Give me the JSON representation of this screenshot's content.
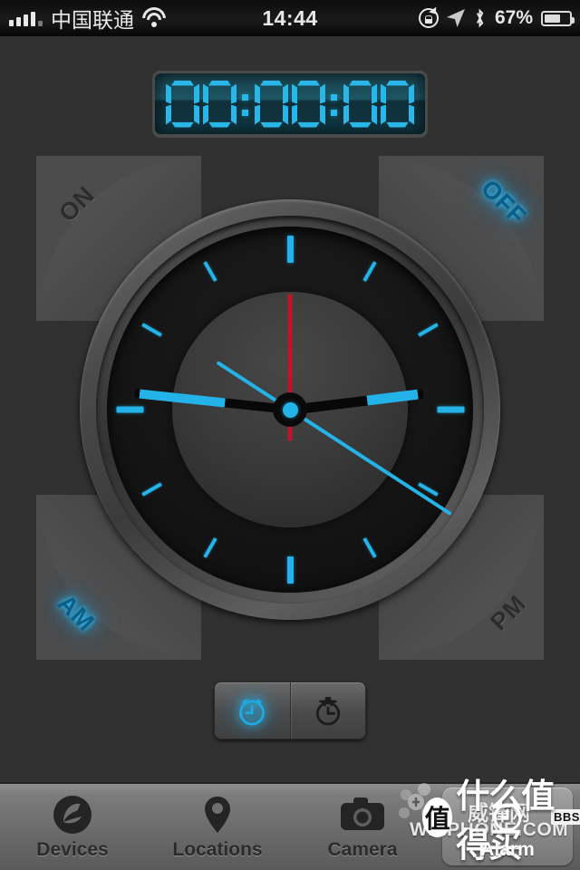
{
  "status_bar": {
    "carrier": "中国联通",
    "time": "14:44",
    "battery_percent": "67%",
    "icons": [
      "signal-bars-icon",
      "wifi-icon",
      "rotation-lock-icon",
      "location-arrow-icon",
      "bluetooth-icon",
      "battery-icon"
    ]
  },
  "display": {
    "value": "00:00:00",
    "digits": [
      "0",
      "0",
      "0",
      "0",
      "0",
      "0"
    ],
    "color": "#29b6e8"
  },
  "corners": [
    {
      "id": "on",
      "label": "ON",
      "active": false
    },
    {
      "id": "off",
      "label": "OFF",
      "active": true
    },
    {
      "id": "am",
      "label": "AM",
      "active": true
    },
    {
      "id": "pm",
      "label": "PM",
      "active": false
    }
  ],
  "clock": {
    "hour_hand_angle": -7,
    "minute_hand_angle": 186,
    "alarm_hand_angle": 33,
    "second_hand_angle": -90,
    "tick_color": "#24b3e8",
    "second_hand_color": "#c0142a",
    "hub_color": "#24b3e8",
    "major_ticks": [
      12,
      3,
      6,
      9
    ],
    "tick_count": 12
  },
  "mode_switch": [
    {
      "id": "alarm",
      "icon": "alarm-clock-icon",
      "label": "Alarm",
      "active": true
    },
    {
      "id": "stopwatch",
      "icon": "stopwatch-icon",
      "label": "Stopwatch",
      "active": false
    }
  ],
  "tab_bar": [
    {
      "id": "devices",
      "label": "Devices",
      "icon": "bird-circle-icon",
      "selected": false
    },
    {
      "id": "locations",
      "label": "Locations",
      "icon": "map-pin-icon",
      "selected": false
    },
    {
      "id": "camera",
      "label": "Camera",
      "icon": "camera-icon",
      "selected": false
    },
    {
      "id": "alarm",
      "label": "Alarm",
      "icon": "alarm-clock-icon",
      "selected": true
    }
  ],
  "watermarks": {
    "weiphone": "WEiPHONE.COM",
    "weifeng": "威锋网",
    "bbs": "BBS",
    "smzdm_badge": "值",
    "smzdm_text": "什么值得买"
  }
}
